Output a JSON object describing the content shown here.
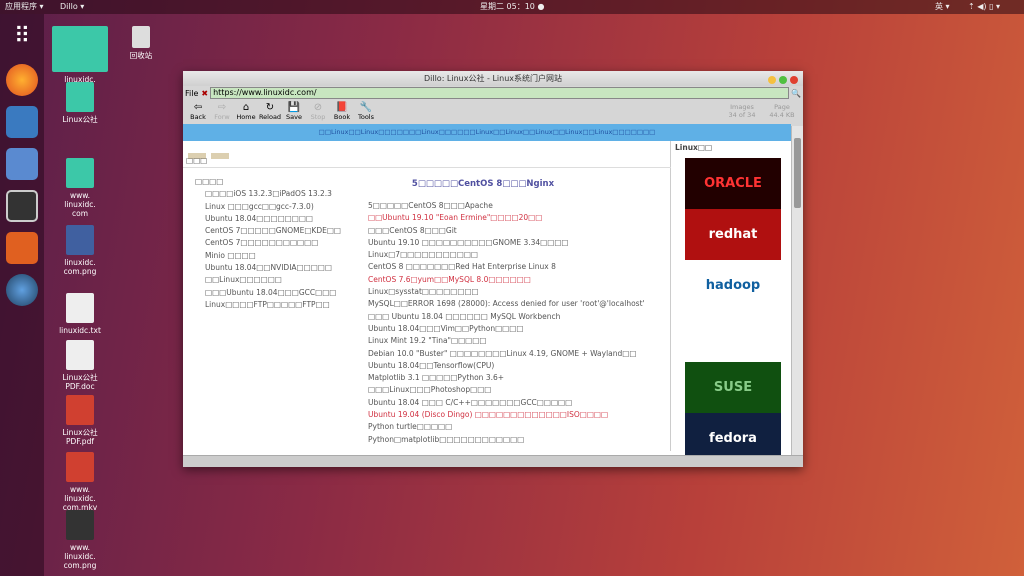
{
  "topbar": {
    "apps": "应用程序 ▾",
    "app": "Dillo ▾",
    "clock": "星期二 05：10 ●",
    "lang": "英 ▾",
    "tray": "⇡ ◀) ▯ ▾"
  },
  "desktop": [
    {
      "label": "linuxidc.\ncom"
    },
    {
      "label": "Linux公社"
    },
    {
      "label": "www.\nlinuxidc.\ncom"
    },
    {
      "label": "linuxidc.\ncom.png"
    },
    {
      "label": "linuxidc.txt"
    },
    {
      "label": "Linux公社\nPDF.doc"
    },
    {
      "label": "Linux公社\nPDF.pdf"
    },
    {
      "label": "www.\nlinuxidc.\ncom.mkv"
    },
    {
      "label": "www.\nlinuxidc.\ncom.png"
    }
  ],
  "trash": "回收站",
  "browser": {
    "title": "Dillo: Linux公社 - Linux系统门户网站",
    "file_menu": "File",
    "url": "https://www.linuxidc.com/",
    "toolbar": [
      "Back",
      "Forw",
      "Home",
      "Reload",
      "Save",
      "Stop",
      "Book",
      "Tools"
    ],
    "images_label": "Images",
    "images_value": "34 of 34",
    "page_label": "Page",
    "page_value": "44.4 KB",
    "band": "□□Linux□□Linux□□□□□□□Linux□□□□□□Linux□□Linux□□Linux□□Linux□□Linux□□□□□□□",
    "top_left": "□□□",
    "sidebar_title": "Linux□□",
    "left_heading": "□□□□",
    "left_items": [
      "□□□□iOS 13.2.3□iPadOS 13.2.3",
      "Linux □□□gcc□□gcc-7.3.0)",
      "Ubuntu 18.04□□□□□□□□",
      "CentOS 7□□□□□GNOME□KDE□□",
      "CentOS 7□□□□□□□□□□□",
      "Minio □□□□",
      "Ubuntu 18.04□□NVIDIA□□□□□",
      "□□Linux□□□□□□",
      "□□□Ubuntu 18.04□□□GCC□□□",
      "Linux□□□□FTP□□□□□FTP□□"
    ],
    "headline": "5□□□□□CentOS 8□□□Nginx",
    "right_items": [
      {
        "text": "5□□□□□CentOS 8□□□Apache",
        "red": false
      },
      {
        "text": "□□Ubuntu 19.10 \"Eoan Ermine\"□□□□20□□",
        "red": true
      },
      {
        "text": "□□□CentOS 8□□□Git",
        "red": false
      },
      {
        "text": "Ubuntu 19.10 □□□□□□□□□□GNOME 3.34□□□□",
        "red": false
      },
      {
        "text": "Linux□7□□□□□□□□□□□",
        "red": false
      },
      {
        "text": "CentOS 8 □□□□□□□Red Hat Enterprise Linux 8",
        "red": false
      },
      {
        "text": "CentOS 7.6□yum□□MySQL 8.0□□□□□□",
        "red": true
      },
      {
        "text": "Linux□sysstat□□□□□□□□",
        "red": false
      },
      {
        "text": "MySQL□□ERROR 1698 (28000): Access denied for user 'root'@'localhost'",
        "red": false
      },
      {
        "text": "□□□ Ubuntu 18.04 □□□□□□ MySQL Workbench",
        "red": false
      },
      {
        "text": "Ubuntu 18.04□□□Vim□□Python□□□□",
        "red": false
      },
      {
        "text": "Linux Mint 19.2 \"Tina\"□□□□□",
        "red": false
      },
      {
        "text": "Debian 10.0 \"Buster\" □□□□□□□□Linux 4.19, GNOME + Wayland□□",
        "red": false
      },
      {
        "text": "Ubuntu 18.04□□Tensorflow(CPU)",
        "red": false
      },
      {
        "text": "Matplotlib 3.1 □□□□□Python 3.6+",
        "red": false
      },
      {
        "text": "□□□Linux□□□Photoshop□□□",
        "red": false
      },
      {
        "text": "Ubuntu 18.04 □□□ C/C++□□□□□□□GCC□□□□□",
        "red": false
      },
      {
        "text": "Ubuntu 19.04 (Disco Dingo) □□□□□□□□□□□□□ISO□□□□",
        "red": true
      },
      {
        "text": "Python turtle□□□□□",
        "red": false
      },
      {
        "text": "Python□matplotlib□□□□□□□□□□□□",
        "red": false
      }
    ],
    "logos": [
      "ORACLE",
      "redhat",
      "hadoop",
      "",
      "SUSE",
      "fedora"
    ]
  }
}
